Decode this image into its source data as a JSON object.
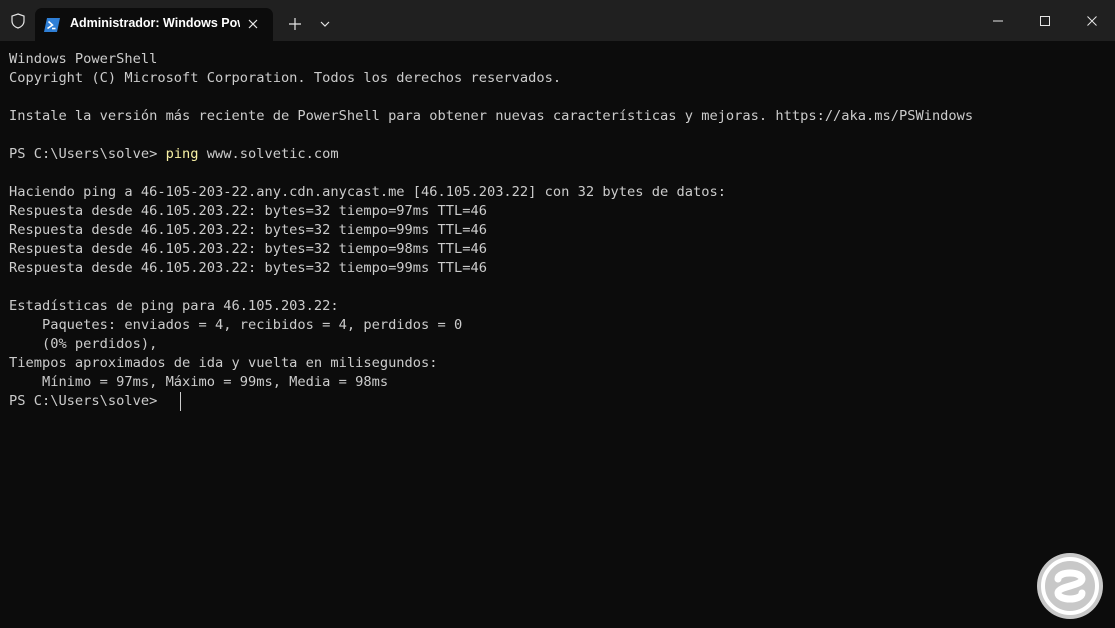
{
  "window": {
    "tab_title": "Administrador: Windows Pow",
    "controls": {
      "minimize_icon": "minimize-icon",
      "maximize_icon": "maximize-icon",
      "close_icon": "close-icon"
    }
  },
  "terminal": {
    "lines": [
      "Windows PowerShell",
      "Copyright (C) Microsoft Corporation. Todos los derechos reservados.",
      "",
      "Instale la versión más reciente de PowerShell para obtener nuevas características y mejoras. https://aka.ms/PSWindows",
      "",
      "",
      "",
      "Haciendo ping a 46-105-203-22.any.cdn.anycast.me [46.105.203.22] con 32 bytes de datos:",
      "Respuesta desde 46.105.203.22: bytes=32 tiempo=97ms TTL=46",
      "Respuesta desde 46.105.203.22: bytes=32 tiempo=99ms TTL=46",
      "Respuesta desde 46.105.203.22: bytes=32 tiempo=98ms TTL=46",
      "Respuesta desde 46.105.203.22: bytes=32 tiempo=99ms TTL=46",
      "",
      "Estadísticas de ping para 46.105.203.22:",
      "    Paquetes: enviados = 4, recibidos = 4, perdidos = 0",
      "    (0% perdidos),",
      "Tiempos aproximados de ida y vuelta en milisegundos:",
      "    Mínimo = 97ms, Máximo = 99ms, Media = 98ms"
    ],
    "command_line": {
      "prompt": "PS C:\\Users\\solve> ",
      "command": "ping",
      "argument": " www.solvetic.com"
    },
    "current_prompt": "PS C:\\Users\\solve> "
  },
  "colors": {
    "background": "#0c0c0c",
    "titlebar": "#202020",
    "text": "#cccccc",
    "command": "#f9f1a5",
    "powershell_icon": "#2f7fd6",
    "watermark": "#c8c8c8"
  }
}
